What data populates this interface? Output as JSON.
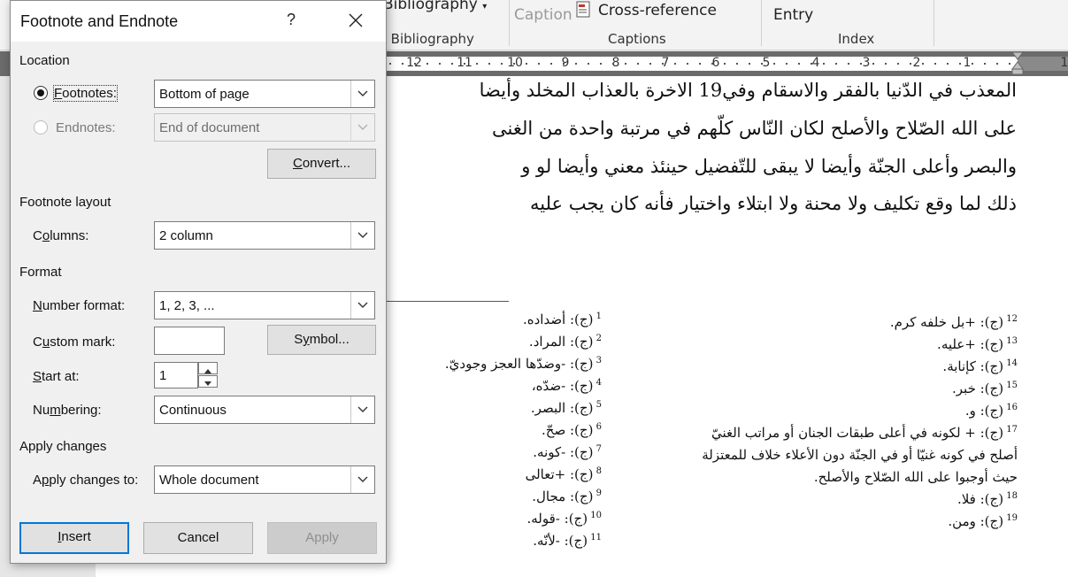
{
  "ribbon": {
    "bibliography_label": "Bibliography",
    "bibliography_group": "t Bibliography",
    "caption_label": "Caption",
    "cross_reference_label": "Cross-reference",
    "captions_group": "Captions",
    "entry_label": "Entry",
    "index_group": "Index"
  },
  "ruler": {
    "numbers": [
      "12",
      "11",
      "10",
      "9",
      "8",
      "7",
      "6",
      "5",
      "4",
      "3",
      "2",
      "1",
      "1"
    ]
  },
  "document": {
    "lines": [
      "المعذب في الدّنيا بالفقر والاسقام وفي19 الاخرة بالعذاب المخلد وأيضا",
      "على الله الصّلاح والأصلح لكان النّاس كلّهم في مرتبة واحدة من الغنى",
      "والبصر وأعلى الجنّة وأيضا لا يبقى للتّفضيل حينئذ معني وأيضا لو و",
      "ذلك لما وقع تكليف ولا محنة ولا ابتلاء واختيار فأنه كان يجب عليه"
    ],
    "footnotes_left": [
      {
        "num": "1",
        "text": "(ج): أضداده."
      },
      {
        "num": "2",
        "text": "(ج): المراد."
      },
      {
        "num": "3",
        "text": "(ج): -وضدّها العجز وجوديّ."
      },
      {
        "num": "4",
        "text": "(ج): -ضدّه،"
      },
      {
        "num": "5",
        "text": "(ج): البصر."
      },
      {
        "num": "6",
        "text": "(ج): صحّ."
      },
      {
        "num": "7",
        "text": "(ج): -كونه."
      },
      {
        "num": "8",
        "text": "(ج): +تعالى"
      },
      {
        "num": "9",
        "text": "(ج): مجال."
      },
      {
        "num": "10",
        "text": "(ج): -قوله."
      },
      {
        "num": "11",
        "text": "(ج): -لأنّه."
      }
    ],
    "footnotes_right": [
      {
        "num": "12",
        "text": "(ج): +بل خلفه كرم."
      },
      {
        "num": "13",
        "text": "(ج): +عليه."
      },
      {
        "num": "14",
        "text": "(ج): كإنابة."
      },
      {
        "num": "15",
        "text": "(ج): خبر."
      },
      {
        "num": "16",
        "text": "(ج): و."
      },
      {
        "num": "17",
        "text": "(ج): + لكونه في أعلى طبقات الجنان أو مراتب الغنيّ"
      },
      {
        "num": "",
        "text": "أصلح في كونه غنيّا أو في الجنّة دون الأعلاء خلاف للمعتزلة"
      },
      {
        "num": "",
        "text": "حيث أوجبوا على الله الصّلاح والأصلح."
      },
      {
        "num": "18",
        "text": "(ج): فلا."
      },
      {
        "num": "19",
        "text": "(ج): ومن."
      }
    ]
  },
  "dialog": {
    "title": "Footnote and Endnote",
    "help": "?",
    "location_section": "Location",
    "footnotes_label": "Footnotes:",
    "footnotes_value": "Bottom of page",
    "endnotes_label": "Endnotes:",
    "endnotes_value": "End of document",
    "convert_button": "Convert...",
    "layout_section": "Footnote layout",
    "columns_label": "Columns:",
    "columns_value": "2 column",
    "format_section": "Format",
    "number_format_label": "Number format:",
    "number_format_value": "1, 2, 3, ...",
    "custom_mark_label": "Custom mark:",
    "custom_mark_value": "",
    "symbol_button": "Symbol...",
    "start_at_label": "Start at:",
    "start_at_value": "1",
    "numbering_label": "Numbering:",
    "numbering_value": "Continuous",
    "apply_section": "Apply changes",
    "apply_to_label": "Apply changes to:",
    "apply_to_value": "Whole document",
    "insert_button": "Insert",
    "cancel_button": "Cancel",
    "apply_button": "Apply"
  },
  "colors": {
    "accent": "#0078d7",
    "dialog_bg": "#f0f0f0",
    "ruler_bg": "#6b6b6b"
  }
}
